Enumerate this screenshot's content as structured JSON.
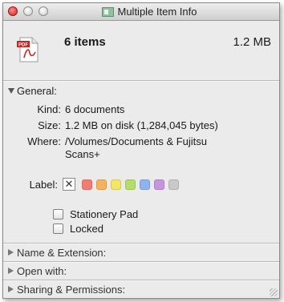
{
  "window": {
    "title": "Multiple Item Info"
  },
  "header": {
    "item_count": "6 items",
    "total_size": "1.2 MB",
    "pdf_badge": "PDF"
  },
  "general": {
    "heading": "General:",
    "kind_label": "Kind:",
    "kind_value": "6 documents",
    "size_label": "Size:",
    "size_value": "1.2 MB on disk (1,284,045 bytes)",
    "where_label": "Where:",
    "where_value_line1": "/Volumes/Documents & Fujitsu",
    "where_value_line2": "Scans+",
    "label_label": "Label:",
    "label_none_symbol": "✕",
    "label_colors": [
      "#f07c74",
      "#f5b25e",
      "#f2e56a",
      "#b6dc6a",
      "#8fb3ee",
      "#c695e0",
      "#c9c9c9"
    ],
    "stationery_label": "Stationery Pad",
    "locked_label": "Locked"
  },
  "sections": {
    "name_extension": "Name & Extension:",
    "open_with": "Open with:",
    "sharing_permissions": "Sharing & Permissions:"
  }
}
